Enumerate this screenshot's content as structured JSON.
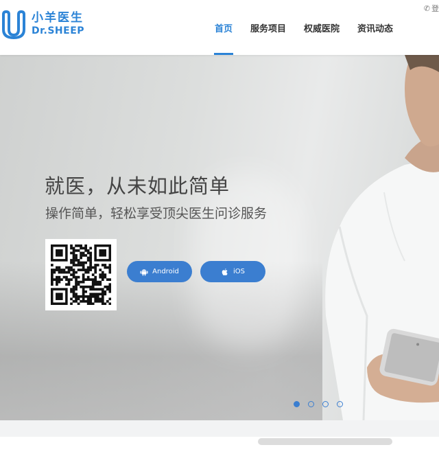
{
  "brand": {
    "name_cn": "小羊医生",
    "name_en": "Dr.SHEEP",
    "accent": "#2b83d6"
  },
  "topbar": {
    "phone_icon": "phone-icon",
    "text": "登"
  },
  "nav": {
    "items": [
      {
        "label": "首页",
        "active": true
      },
      {
        "label": "服务项目",
        "active": false
      },
      {
        "label": "权威医院",
        "active": false
      },
      {
        "label": "资讯动态",
        "active": false
      }
    ]
  },
  "hero": {
    "headline": "就医，从未如此简单",
    "subline": "操作简单，轻松享受顶尖医生问诊服务",
    "buttons": {
      "android": "Android",
      "ios": "iOS"
    },
    "button_color": "#3b7ed0",
    "carousel": {
      "count": 4,
      "active_index": 0
    }
  }
}
